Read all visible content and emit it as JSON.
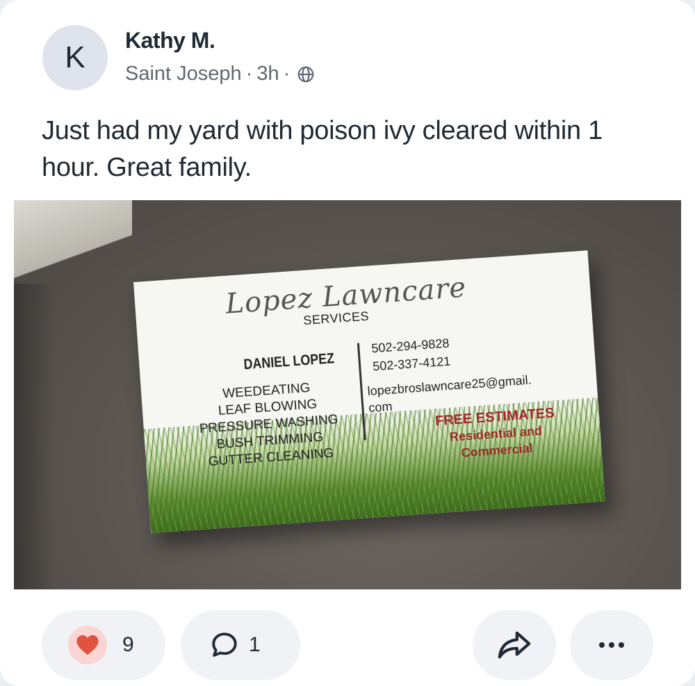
{
  "post": {
    "avatar_initial": "K",
    "author": "Kathy M.",
    "location": "Saint Joseph",
    "separator": "·",
    "time": "3h",
    "visibility_icon": "globe-icon",
    "text": "Just had my yard with poison ivy cleared within 1 hour. Great family."
  },
  "photo": {
    "business_card": {
      "script_title": "Lopez Lawncare",
      "subtitle": "SERVICES",
      "name": "DANIEL LOPEZ",
      "services": [
        "WEEDEATING",
        "LEAF BLOWING",
        "PRESSURE WASHING",
        "BUSH TRIMMING",
        "GUTTER CLEANING"
      ],
      "phones": [
        "502-294-9828",
        "502-337-4121"
      ],
      "email_line1": "lopezbroslawncare25@gmail.",
      "email_line2": "com",
      "free_estimates": "FREE ESTIMATES",
      "residential": "Residential and",
      "commercial": "Commercial"
    }
  },
  "actions": {
    "like_icon": "heart-icon",
    "like_count": "9",
    "comment_icon": "comment-icon",
    "comment_count": "1",
    "share_icon": "share-icon",
    "more_icon": "more-icon"
  },
  "colors": {
    "heart": "#e0533f",
    "heart_bg": "#fbd5d3",
    "pill_bg": "#f1f2f5",
    "avatar_bg": "#dfe3ec",
    "estimate_red": "#a3262a"
  }
}
